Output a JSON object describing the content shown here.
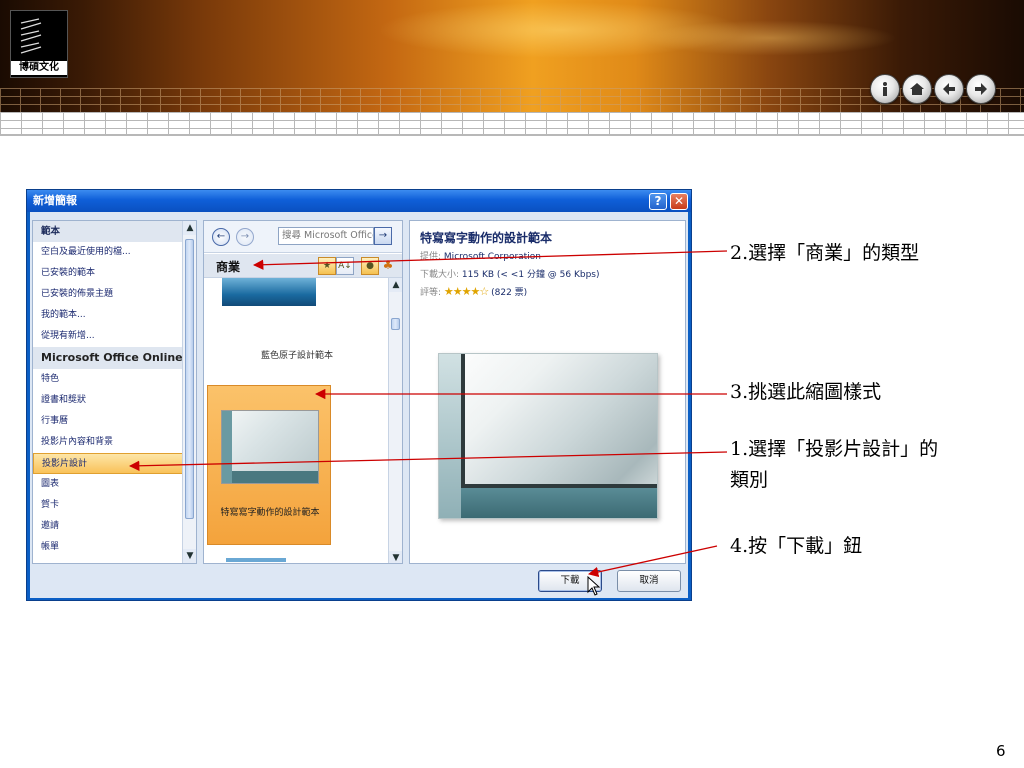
{
  "branding": {
    "logo_text": "博碩文化",
    "nav_icons": [
      "info-icon",
      "home-icon",
      "back-icon",
      "forward-icon"
    ]
  },
  "dialog": {
    "title": "新增簡報",
    "help_label": "?",
    "close_label": "✕",
    "categories": [
      {
        "label": "範本",
        "type": "header"
      },
      {
        "label": "空白及最近使用的檔...",
        "type": "item"
      },
      {
        "label": "已安裝的範本",
        "type": "item"
      },
      {
        "label": "已安裝的佈景主題",
        "type": "item"
      },
      {
        "label": "我的範本...",
        "type": "item"
      },
      {
        "label": "從現有新增...",
        "type": "item"
      },
      {
        "label": "Microsoft Office Online",
        "type": "section"
      },
      {
        "label": "特色",
        "type": "item"
      },
      {
        "label": "證書和獎狀",
        "type": "item"
      },
      {
        "label": "行事曆",
        "type": "item"
      },
      {
        "label": "投影片內容和背景",
        "type": "item"
      },
      {
        "label": "投影片設計",
        "type": "selected"
      },
      {
        "label": "圖表",
        "type": "item"
      },
      {
        "label": "賀卡",
        "type": "item"
      },
      {
        "label": "邀請",
        "type": "item"
      },
      {
        "label": "帳單",
        "type": "item"
      }
    ],
    "search_placeholder": "搜尋 Microsoft Office Online",
    "category_header": "商業",
    "thumbnails": [
      {
        "label": "藍色原子設計範本"
      },
      {
        "label": "特寫寫字動作的設計範本"
      }
    ],
    "preview": {
      "title": "特寫寫字動作的設計範本",
      "provider_label": "提供:",
      "provider_value": "Microsoft Corporation",
      "size_label": "下載大小:",
      "size_value": "115 KB (< <1 分鐘 @ 56 Kbps)",
      "rating_label": "評等:",
      "rating_stars": "★★★★☆",
      "rating_value": 4,
      "rating_count": "(822 票)"
    },
    "buttons": {
      "download": "下載",
      "cancel": "取消"
    }
  },
  "annotations": {
    "step2": "2.選擇「商業」的類型",
    "step3": "3.挑選此縮圖樣式",
    "step1_line1": "1.選擇「投影片設計」的",
    "step1_line2": "類別",
    "step4": "4.按「下載」鈕"
  },
  "page_number": "6",
  "colors": {
    "dialog_frame": "#0b5fc5",
    "selection": "#f4a33c",
    "annotation_arrow": "#cc0000"
  }
}
